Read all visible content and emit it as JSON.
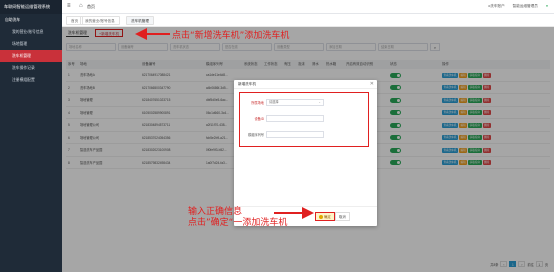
{
  "app": {
    "title": "车联网智能运维管理系统"
  },
  "sidebar": {
    "items": [
      {
        "label": "自助洗车",
        "kind": "parent"
      },
      {
        "label": "我的营业/账号信息",
        "kind": "sub"
      },
      {
        "label": "场地管理",
        "kind": "sub"
      },
      {
        "label": "洗车机管理",
        "kind": "sub-active"
      },
      {
        "label": "洗车操作记录",
        "kind": "sub"
      },
      {
        "label": "注册模组配置",
        "kind": "sub"
      }
    ]
  },
  "topbar": {
    "menu_icon": "≡",
    "home_icon": "⌂",
    "breadcrumb": "首页",
    "user": "o洗车账户",
    "org": "智能运维管理员",
    "status": "●"
  },
  "tabs": [
    {
      "label": "首页"
    },
    {
      "label": "我的营业/账号信息"
    },
    {
      "label": "洗车机管理"
    }
  ],
  "main": {
    "subtab": "洗车机管理",
    "add_button": "+新增洗车机",
    "filters": [
      "场地名称",
      "设备编号",
      "洗车机状态",
      "是否在线",
      "设备类型",
      "添加日期",
      "结束日期"
    ],
    "search_icon": "⌕",
    "columns": [
      "序号",
      "场地",
      "设备编号",
      "模组序列号",
      "系统状态",
      "工作状态",
      "有压",
      "泡沫",
      "清水",
      "热水箱",
      "开启有效自动识别",
      "状态",
      "操作"
    ],
    "rows": [
      {
        "no": "1",
        "site": "洗车场地A",
        "device": "6217064917088421",
        "module": "ca1de11e4d8...",
        "sys": "",
        "work": "",
        "sw": true
      },
      {
        "no": "2",
        "site": "洗车场地B",
        "device": "6217066500347790",
        "module": "a4b0686f-3d5...",
        "sys": "",
        "work": "",
        "sw": true
      },
      {
        "no": "3",
        "site": "场地管理",
        "device": "6218407651023715",
        "module": "dbf5d0e5-6ac...",
        "sys": "",
        "work": "",
        "sw": true
      },
      {
        "no": "4",
        "site": "场地管理",
        "device": "6105002589900891",
        "module": "06c1d660-3c4...",
        "sys": "",
        "work": "",
        "sw": true
      },
      {
        "no": "5",
        "site": "场地管理公司",
        "device": "6218304894573711",
        "module": "a2f11f70-438...",
        "sys": "",
        "work": "",
        "sw": true
      },
      {
        "no": "6",
        "site": "场地管理公司",
        "device": "6218537024054356",
        "module": "fcb5e2b9-a21...",
        "sys": "",
        "work": "",
        "sw": true
      },
      {
        "no": "7",
        "site": "智选洗车产品园",
        "device": "6218302023100908",
        "module": "0f0fe9f3-b52...",
        "sys": "",
        "work": "",
        "sw": true
      },
      {
        "no": "8",
        "site": "智选洗车产品园",
        "device": "6218579832498434",
        "module": "1a0f7d24-fa3...",
        "sys": "",
        "work": "",
        "sw": true
      }
    ],
    "ops": [
      "查看洗车机",
      "编辑",
      "获取指令",
      "删除"
    ],
    "pager": {
      "total": "共8条",
      "page": "1",
      "goto": "前往",
      "page_unit": "页"
    }
  },
  "modal": {
    "title": "新增洗车机",
    "close_icon": "✕",
    "fields": [
      {
        "label": "所属场地",
        "value": "请选择",
        "required": true,
        "dropdown": true
      },
      {
        "label": "设备ID",
        "value": "",
        "required": true,
        "dropdown": false
      },
      {
        "label": "模组序列号",
        "value": "",
        "required": false,
        "dropdown": false
      }
    ],
    "ok_label": "确定",
    "cancel_label": "取消"
  },
  "annotations": {
    "top": "点击“新增洗车机”添加洗车机",
    "bottom_line1": "输入正确信息",
    "bottom_line2": "点击”确定“一添加洗车机"
  },
  "colors": {
    "accent": "#c9313a",
    "highlight": "#e02020",
    "sidebar": "#1f2b38",
    "toggle_on": "#2aaa5a"
  }
}
